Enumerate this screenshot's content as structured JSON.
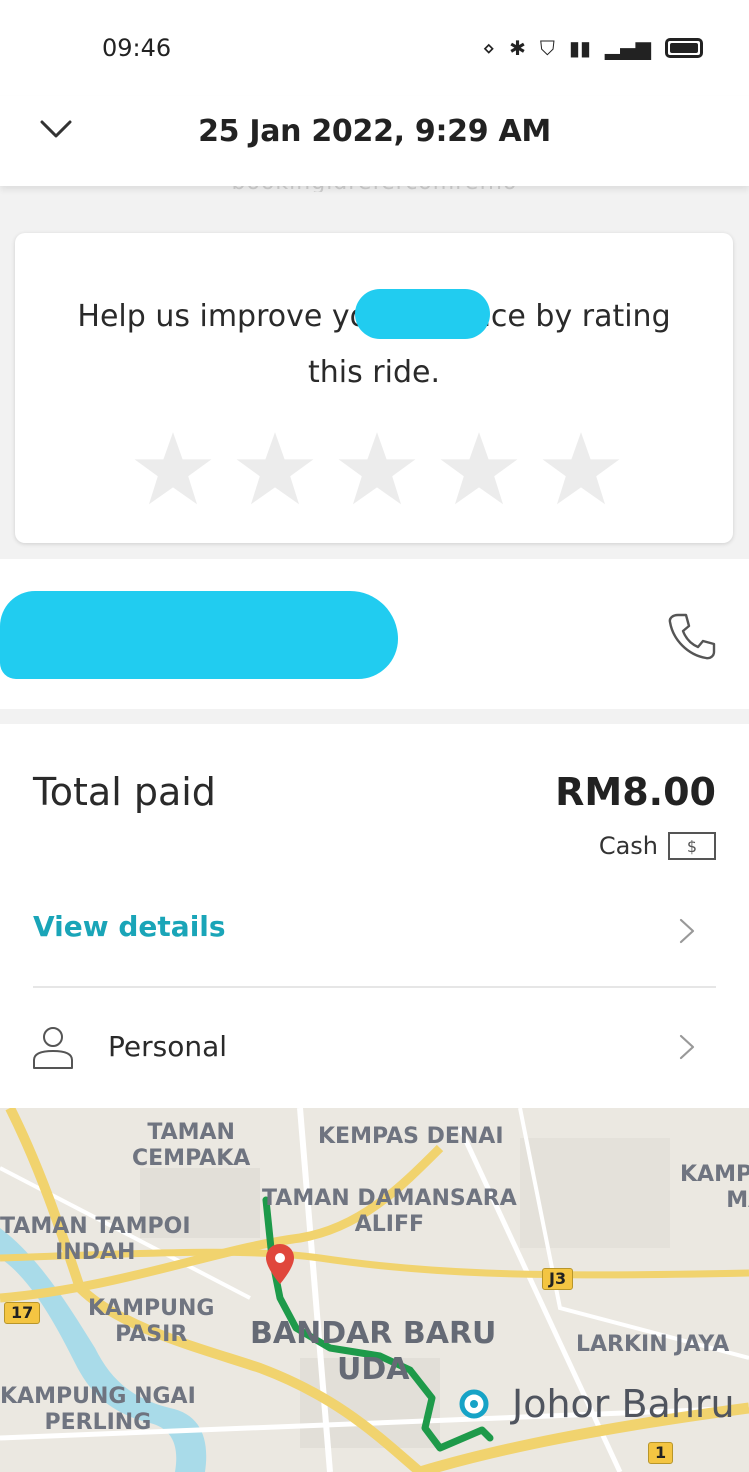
{
  "status_bar": {
    "time": "09:46",
    "icons": [
      "vibrate-icon",
      "bluetooth-icon",
      "vpn-icon",
      "signal-icon",
      "lte-signal-icon",
      "battery-icon"
    ]
  },
  "header": {
    "title": "25 Jan 2022, 9:29 AM",
    "back_icon": "chevron-down-icon"
  },
  "rating": {
    "prompt": "Help us improve yo           xperience by rating this ride.",
    "star_count": 5,
    "selected": 0
  },
  "driver": {
    "call_icon": "phone-icon"
  },
  "payment": {
    "total_label": "Total paid",
    "total_amount": "RM8.00",
    "method_label": "Cash",
    "method_icon_text": "$",
    "view_details": "View details",
    "profile_label": "Personal",
    "accent_color": "#1aa5b8"
  },
  "map": {
    "labels": {
      "taman_cempaka": "TAMAN CEMPAKA",
      "kempas_denai": "KEMPAS DENAI",
      "taman_damansara": "TAMAN DAMANSARA ALIFF",
      "taman_tampoi": "TAMAN TAMPOI INDAH",
      "kampung_pasir": "KAMPUNG PASIR",
      "bandar_baru_uda": "BANDAR BARU UDA",
      "kampung_sungai": "KAMPUNG NGAI PERLING",
      "larkin_jaya": "LARKIN JAYA",
      "kamp_mela": "KAMP MELA MAJI",
      "city": "Johor Bahru"
    },
    "road_badges": {
      "r17": "17",
      "j3": "J3",
      "r1": "1"
    },
    "route_color": "#1e9a4a",
    "pickup_pin_color": "#e0473c"
  }
}
